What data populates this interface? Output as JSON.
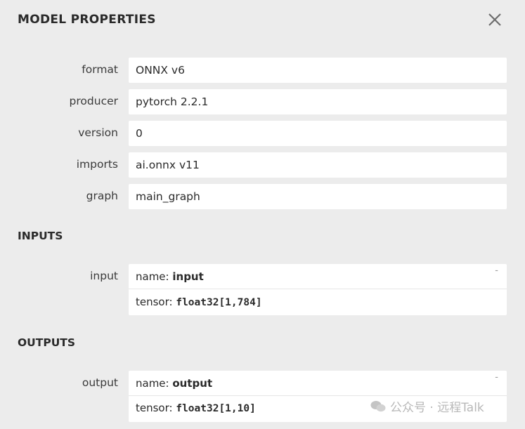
{
  "dialog": {
    "title": "MODEL PROPERTIES"
  },
  "properties": [
    {
      "label": "format",
      "value": "ONNX v6"
    },
    {
      "label": "producer",
      "value": "pytorch 2.2.1"
    },
    {
      "label": "version",
      "value": "0"
    },
    {
      "label": "imports",
      "value": "ai.onnx v11"
    },
    {
      "label": "graph",
      "value": "main_graph"
    }
  ],
  "inputs": {
    "heading": "INPUTS",
    "items": [
      {
        "label": "input",
        "name_prefix": "name: ",
        "name": "input",
        "tensor_prefix": "tensor: ",
        "tensor": "float32[1,784]",
        "toggle": "-"
      }
    ]
  },
  "outputs": {
    "heading": "OUTPUTS",
    "items": [
      {
        "label": "output",
        "name_prefix": "name: ",
        "name": "output",
        "tensor_prefix": "tensor: ",
        "tensor": "float32[1,10]",
        "toggle": "-"
      }
    ]
  },
  "watermark": {
    "text": "公众号 · 远程Talk"
  }
}
